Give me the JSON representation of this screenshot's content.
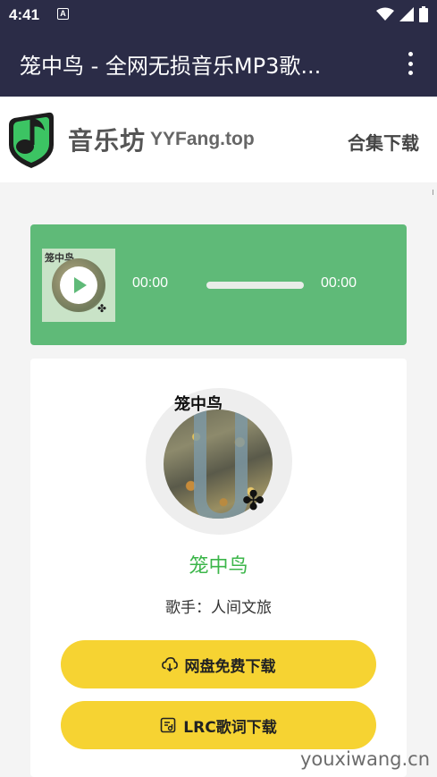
{
  "status_bar": {
    "time": "4:41",
    "notification_icon": "a-box-icon",
    "wifi_icon": "wifi-icon",
    "signal_icon": "signal-icon",
    "battery_icon": "battery-icon"
  },
  "app_bar": {
    "title": "笼中鸟 - 全网无损音乐MP3歌...",
    "menu_icon": "more-vert-icon"
  },
  "site_header": {
    "logo_icon": "music-note-logo-icon",
    "logo_text": "音乐坊",
    "logo_domain": "YYFang.top",
    "collection_link": "合集下载"
  },
  "player": {
    "cover_title": "笼中鸟",
    "play_icon": "play-icon",
    "time_start": "00:00",
    "time_end": "00:00",
    "progress": 0
  },
  "song": {
    "cover_title": "笼中鸟",
    "title": "笼中鸟",
    "artist": "歌手：人间文旅"
  },
  "buttons": {
    "netdisk_label": "网盘免费下载",
    "netdisk_icon": "cloud-download-icon",
    "lrc_label": "LRC歌词下载",
    "lrc_icon": "lyrics-file-icon"
  },
  "watermark": "youxiwang.cn",
  "colors": {
    "app_bar": "#2b2c47",
    "player_green": "#5fba78",
    "title_green": "#3cb64a",
    "button_yellow": "#f6d332"
  }
}
